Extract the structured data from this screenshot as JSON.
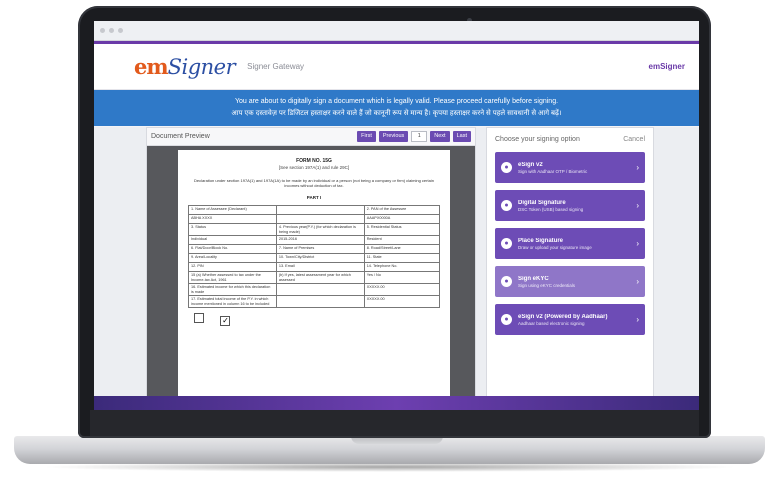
{
  "app": {
    "logo_em": "em",
    "logo_signer": "Signer",
    "header_subtitle": "Signer Gateway",
    "header_right": "emSigner"
  },
  "banner": {
    "line1": "You are about to digitally sign a document which is legally valid. Please proceed carefully before signing.",
    "line2": "आप एक दस्तावेज़ पर डिजिटल हस्ताक्षर करने वाले हैं जो कानूनी रूप से मान्य है। कृपया हस्ताक्षर करने से पहले सावधानी से आगे बढ़ें।"
  },
  "document_preview": {
    "title": "Document Preview",
    "buttons": {
      "first": "First",
      "previous": "Previous",
      "next": "Next",
      "last": "Last"
    },
    "page_select": "1"
  },
  "document": {
    "heading": "FORM NO. 15G",
    "subheading": "[See section 197A(1) and rule 29C]",
    "note": "Declaration under section 197A(1) and 197A(1A) to be made by an individual or a person (not being a company or firm) claiming certain incomes without deduction of tax.",
    "part": "PART I",
    "rows": [
      [
        "1. Name of Assessee (Declarant)",
        "",
        "2. PAN of the Assessee"
      ],
      [
        "ABHA XXXX",
        "",
        "AAAPX0000A"
      ],
      [
        "3. Status",
        "4. Previous year(P.Y.) (for which declaration is being made)",
        "5. Residential Status"
      ],
      [
        "Individual",
        "2015-2016",
        "Resident"
      ],
      [
        "6. Flat/Door/Block No.",
        "7. Name of Premises",
        "8. Road/Street/Lane"
      ],
      [
        "9. Area/Locality",
        "10. Town/City/District",
        "11. State"
      ],
      [
        "12. PIN",
        "13. Email",
        "14. Telephone No."
      ],
      [
        "15 (a) Whether assessed to tax under the Income-tax Act, 1961",
        "(b) If yes, latest assessment year for which assessed",
        "Yes / No"
      ],
      [
        "16. Estimated income for which this declaration is made",
        "",
        "XXXXX.00"
      ],
      [
        "17. Estimated total income of the P.Y. in which income mentioned in column 16 to be included",
        "",
        "XXXXX.00"
      ]
    ]
  },
  "signing_options": {
    "title": "Choose your signing option",
    "cancel": "Cancel",
    "options": [
      {
        "label": "eSign v2",
        "desc": "Sign with Aadhaar OTP / Biometric",
        "icon": "fingerprint-icon"
      },
      {
        "label": "Digital Signature",
        "desc": "DSC Token (USB) based signing",
        "icon": "usb-token-icon"
      },
      {
        "label": "Place Signature",
        "desc": "Draw or upload your signature image",
        "icon": "pen-icon"
      },
      {
        "label": "Sign eKYC",
        "desc": "Sign using eKYC credentials",
        "icon": "id-card-icon"
      },
      {
        "label": "eSign v2 (Powered by Aadhaar)",
        "desc": "Aadhaar based electronic signing",
        "icon": "aadhaar-icon"
      }
    ]
  },
  "colors": {
    "brand_purple": "#6d4cb6",
    "banner_blue": "#2f79c8",
    "logo_orange": "#e25a1c",
    "logo_blue": "#2c4fa3"
  }
}
